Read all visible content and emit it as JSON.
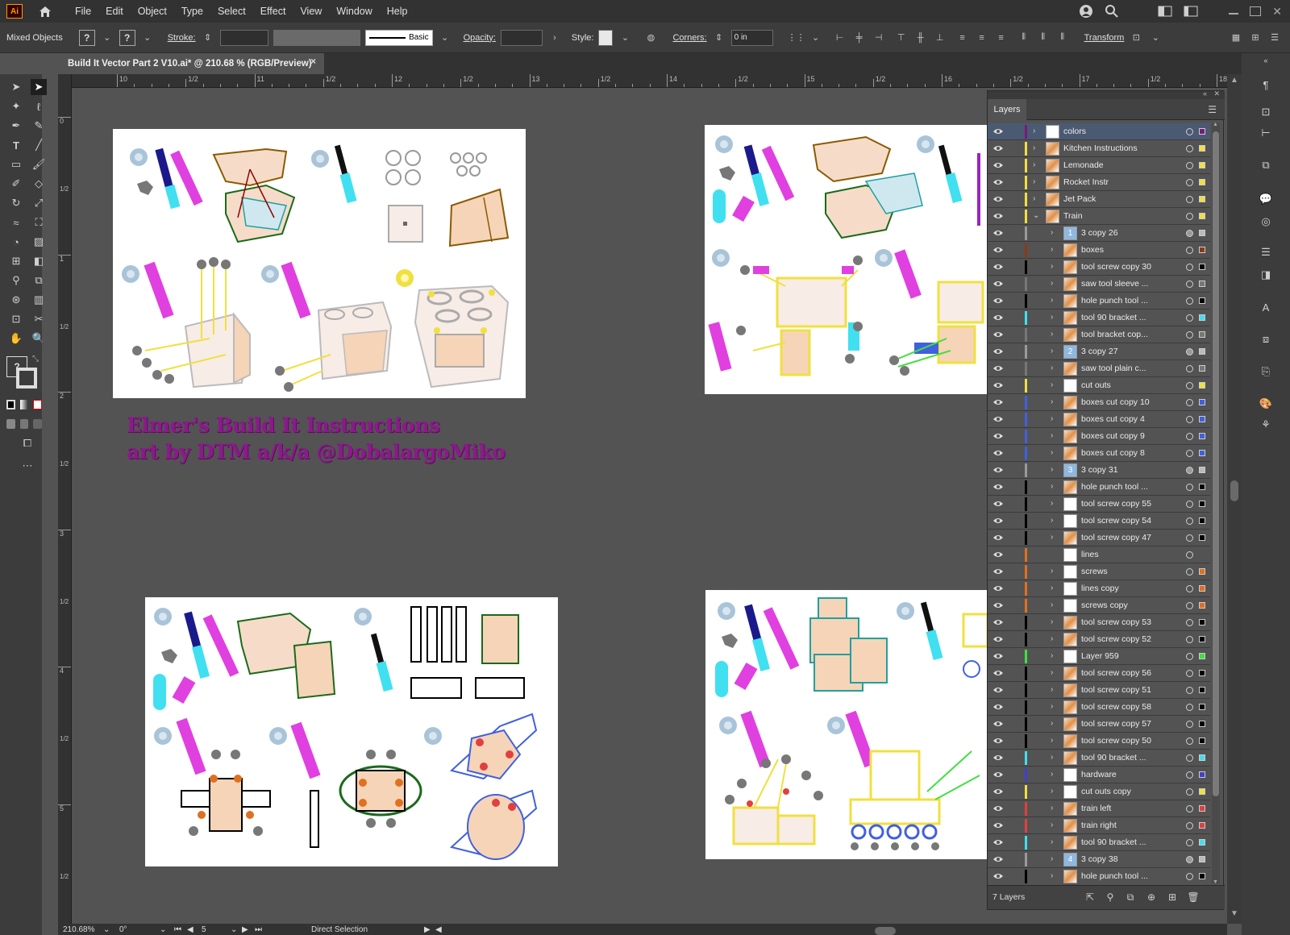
{
  "app": {
    "logo": "Ai",
    "menus": [
      "File",
      "Edit",
      "Object",
      "Type",
      "Select",
      "Effect",
      "View",
      "Window",
      "Help"
    ]
  },
  "controlbar": {
    "selection": "Mixed Objects",
    "stroke_label": "Stroke:",
    "brush_label": "Basic",
    "opacity_label": "Opacity:",
    "style_label": "Style:",
    "corners_label": "Corners:",
    "corners_value": "0 in",
    "transform_label": "Transform",
    "unknown": "?"
  },
  "document": {
    "tab_title": "Build It Vector Part 2 V10.ai* @ 210.68 % (RGB/Preview)",
    "close": "×"
  },
  "rulers": {
    "h_major": [
      "10",
      "11",
      "12",
      "13",
      "14",
      "15",
      "16",
      "17",
      "18"
    ],
    "h_minor": "1/2",
    "v_major": [
      "0",
      "1",
      "2",
      "3",
      "4",
      "5"
    ],
    "v_minor": "1/2"
  },
  "artwork": {
    "title_line1": "Elmer's Build It Instructions",
    "title_line2": "art by DTM a/k/a @DobalargoMiko"
  },
  "status": {
    "zoom": "210.68%",
    "rotation": "0°",
    "artboard": "5",
    "tool": "Direct Selection"
  },
  "layers_panel": {
    "tab": "Layers",
    "count": "7 Layers",
    "rows": [
      {
        "name": "colors",
        "level": 0,
        "expand": "right",
        "color": "#7a1a7a",
        "swatch": "#7a1a7a",
        "selected": true,
        "thumb": "white"
      },
      {
        "name": "Kitchen Instructions",
        "level": 0,
        "expand": "right",
        "color": "#f0e040",
        "swatch": "#f0e040",
        "thumb": "art"
      },
      {
        "name": "Lemonade",
        "level": 0,
        "expand": "right",
        "color": "#f0e040",
        "swatch": "#f0e040",
        "thumb": "art"
      },
      {
        "name": "Rocket Instr",
        "level": 0,
        "expand": "right",
        "color": "#f0e040",
        "swatch": "#f0e040",
        "thumb": "art"
      },
      {
        "name": "Jet Pack",
        "level": 0,
        "expand": "right",
        "color": "#f0e040",
        "swatch": "#f0e040",
        "thumb": "art"
      },
      {
        "name": "Train",
        "level": 0,
        "expand": "down",
        "color": "#f0e040",
        "swatch": "#f0e040",
        "thumb": "art"
      },
      {
        "name": "3 copy 26",
        "level": 1,
        "expand": "right",
        "color": "#9a9a9a",
        "swatch": "#bbbbbb",
        "thumb": "num",
        "num": "1",
        "filled": true
      },
      {
        "name": "boxes",
        "level": 1,
        "expand": "right",
        "color": "#8b3a1a",
        "swatch": "#8b3a1a",
        "thumb": "art"
      },
      {
        "name": "tool screw copy 30",
        "level": 1,
        "expand": "right",
        "color": "#000000",
        "swatch": "#000000",
        "thumb": "art"
      },
      {
        "name": "saw tool sleeve ...",
        "level": 1,
        "expand": "right",
        "color": "#777777",
        "swatch": "#777777",
        "thumb": "art"
      },
      {
        "name": "hole punch tool ...",
        "level": 1,
        "expand": "right",
        "color": "#000000",
        "swatch": "#000000",
        "thumb": "art"
      },
      {
        "name": "tool 90 bracket ...",
        "level": 1,
        "expand": "right",
        "color": "#40e0f0",
        "swatch": "#40e0f0",
        "thumb": "art"
      },
      {
        "name": "tool bracket cop...",
        "level": 1,
        "expand": "right",
        "color": "#777777",
        "swatch": "#777777",
        "thumb": "art"
      },
      {
        "name": "3 copy 27",
        "level": 1,
        "expand": "right",
        "color": "#9a9a9a",
        "swatch": "#bbbbbb",
        "thumb": "num",
        "num": "2",
        "filled": true
      },
      {
        "name": "saw tool plain c...",
        "level": 1,
        "expand": "right",
        "color": "#777777",
        "swatch": "#777777",
        "thumb": "art"
      },
      {
        "name": "cut outs",
        "level": 1,
        "expand": "right",
        "color": "#f0e040",
        "swatch": "#f0e040",
        "thumb": "white"
      },
      {
        "name": "boxes cut copy 10",
        "level": 1,
        "expand": "right",
        "color": "#4060e0",
        "swatch": "#4060e0",
        "thumb": "art"
      },
      {
        "name": "boxes cut copy 4",
        "level": 1,
        "expand": "right",
        "color": "#4060e0",
        "swatch": "#4060e0",
        "thumb": "art"
      },
      {
        "name": "boxes cut copy 9",
        "level": 1,
        "expand": "right",
        "color": "#4060e0",
        "swatch": "#4060e0",
        "thumb": "art"
      },
      {
        "name": "boxes cut copy 8",
        "level": 1,
        "expand": "right",
        "color": "#4060e0",
        "swatch": "#4060e0",
        "thumb": "art"
      },
      {
        "name": "3 copy 31",
        "level": 1,
        "expand": "right",
        "color": "#9a9a9a",
        "swatch": "#bbbbbb",
        "thumb": "num",
        "num": "3",
        "filled": true
      },
      {
        "name": "hole punch tool ...",
        "level": 1,
        "expand": "right",
        "color": "#000000",
        "swatch": "#000000",
        "thumb": "art"
      },
      {
        "name": "tool screw copy 55",
        "level": 1,
        "expand": "right",
        "color": "#000000",
        "swatch": "#000000",
        "thumb": "white"
      },
      {
        "name": "tool screw copy 54",
        "level": 1,
        "expand": "right",
        "color": "#000000",
        "swatch": "#000000",
        "thumb": "white"
      },
      {
        "name": "tool screw copy 47",
        "level": 1,
        "expand": "right",
        "color": "#000000",
        "swatch": "#000000",
        "thumb": "art"
      },
      {
        "name": "lines",
        "level": 1,
        "expand": "none",
        "color": "#e07020",
        "swatch": "",
        "thumb": "white"
      },
      {
        "name": "screws",
        "level": 1,
        "expand": "right",
        "color": "#e07020",
        "swatch": "#e07020",
        "thumb": "white"
      },
      {
        "name": "lines copy",
        "level": 1,
        "expand": "right",
        "color": "#e07020",
        "swatch": "#e07020",
        "thumb": "white"
      },
      {
        "name": "screws copy",
        "level": 1,
        "expand": "right",
        "color": "#e07020",
        "swatch": "#e07020",
        "thumb": "white"
      },
      {
        "name": "tool screw copy 53",
        "level": 1,
        "expand": "right",
        "color": "#000000",
        "swatch": "#000000",
        "thumb": "art"
      },
      {
        "name": "tool screw copy 52",
        "level": 1,
        "expand": "right",
        "color": "#000000",
        "swatch": "#000000",
        "thumb": "art"
      },
      {
        "name": "Layer 959",
        "level": 1,
        "expand": "right",
        "color": "#40e040",
        "swatch": "#40e040",
        "thumb": "white"
      },
      {
        "name": "tool screw copy 56",
        "level": 1,
        "expand": "right",
        "color": "#000000",
        "swatch": "#000000",
        "thumb": "art"
      },
      {
        "name": "tool screw copy 51",
        "level": 1,
        "expand": "right",
        "color": "#000000",
        "swatch": "#000000",
        "thumb": "art"
      },
      {
        "name": "tool screw copy 58",
        "level": 1,
        "expand": "right",
        "color": "#000000",
        "swatch": "#000000",
        "thumb": "art"
      },
      {
        "name": "tool screw copy 57",
        "level": 1,
        "expand": "right",
        "color": "#000000",
        "swatch": "#000000",
        "thumb": "art"
      },
      {
        "name": "tool screw copy 50",
        "level": 1,
        "expand": "right",
        "color": "#000000",
        "swatch": "#000000",
        "thumb": "art"
      },
      {
        "name": "tool 90 bracket ...",
        "level": 1,
        "expand": "right",
        "color": "#40e0f0",
        "swatch": "#40e0f0",
        "thumb": "art"
      },
      {
        "name": "hardware",
        "level": 1,
        "expand": "right",
        "color": "#4040d0",
        "swatch": "#4040d0",
        "thumb": "white"
      },
      {
        "name": "cut outs copy",
        "level": 1,
        "expand": "right",
        "color": "#f0e040",
        "swatch": "#f0e040",
        "thumb": "white"
      },
      {
        "name": "train left",
        "level": 1,
        "expand": "right",
        "color": "#e04040",
        "swatch": "#e04040",
        "thumb": "art"
      },
      {
        "name": "train right",
        "level": 1,
        "expand": "right",
        "color": "#e04040",
        "swatch": "#e04040",
        "thumb": "art"
      },
      {
        "name": "tool 90 bracket ...",
        "level": 1,
        "expand": "right",
        "color": "#40e0f0",
        "swatch": "#40e0f0",
        "thumb": "art"
      },
      {
        "name": "3 copy 38",
        "level": 1,
        "expand": "right",
        "color": "#9a9a9a",
        "swatch": "#bbbbbb",
        "thumb": "num",
        "num": "4",
        "filled": true
      },
      {
        "name": "hole punch tool ...",
        "level": 1,
        "expand": "right",
        "color": "#000000",
        "swatch": "#000000",
        "thumb": "art"
      }
    ]
  }
}
